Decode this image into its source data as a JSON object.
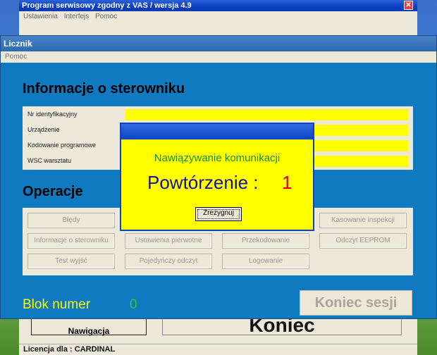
{
  "main_window": {
    "title": "Program serwisowy zgodny z VAS / wersja 4.9",
    "menu": [
      "Ustawienia",
      "Interfejs",
      "Pomoc"
    ],
    "nav_button": "Nawigacja",
    "koniec_button": "Koniec",
    "license": "Licencja dla : CARDINAL"
  },
  "licznik_window": {
    "title": "Licznik",
    "menu": [
      "Pomoc"
    ],
    "info_section_title": "Informacje o sterowniku",
    "info_rows": [
      {
        "label": "Nr identyfikacyjny",
        "value": ""
      },
      {
        "label": "Urządzenie",
        "value": ""
      },
      {
        "label": "Kodowanie programowe",
        "value": ""
      },
      {
        "label": "WSC warsztatu",
        "value": ""
      }
    ],
    "ops_section_title": "Operacje",
    "ops_buttons": [
      [
        "Błędy",
        "",
        "",
        "Kasowanie inspekcji"
      ],
      [
        "Informacje o sterowniku",
        "Ustawienia pierwotne",
        "Przekodowanie",
        "Odczyt EEPROM"
      ],
      [
        "Test wyjść",
        "Pojedyńczy odczyt",
        "Logowanie",
        ""
      ]
    ],
    "blok_label": "Blok numer",
    "blok_value": "0",
    "koniec_sesji_button": "Koniec sesji"
  },
  "dialog": {
    "message": "Nawiązywanie komunikacji",
    "repeat_label": "Powtórzenie :",
    "repeat_value": "1",
    "cancel_button": "Zrezygnuj"
  },
  "colors": {
    "licznik_bg": "#0f7ac0",
    "field_yellow": "#ffff00",
    "dialog_bg": "#ffff00",
    "blok_label": "#ffff00",
    "blok_value": "#22d43a"
  }
}
